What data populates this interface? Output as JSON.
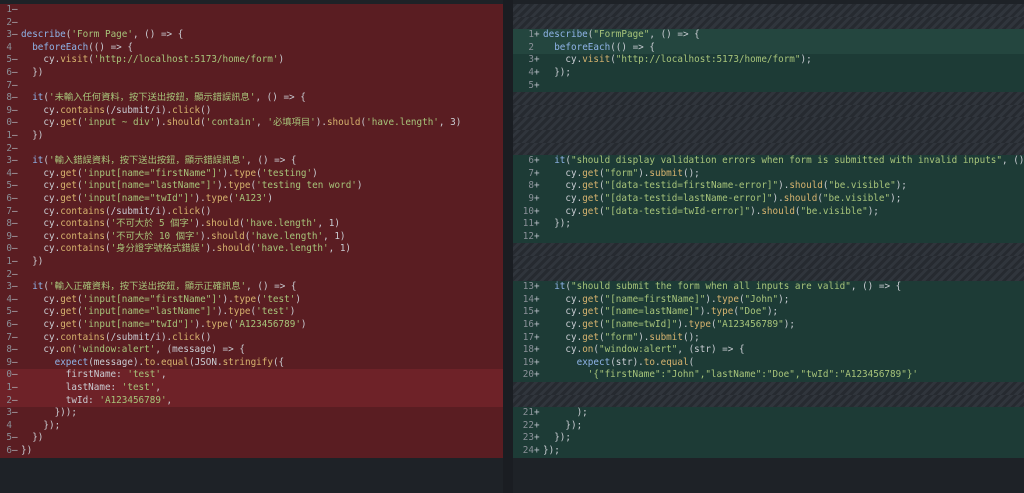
{
  "left_pane": {
    "lines": [
      {
        "n": "1",
        "sign": "—",
        "text": ""
      },
      {
        "n": "2",
        "sign": "—",
        "text": ""
      },
      {
        "n": "3",
        "sign": "—",
        "text": "describe('Form Page', () => {"
      },
      {
        "n": "4",
        "sign": "",
        "text": "  beforeEach(() => {"
      },
      {
        "n": "5",
        "sign": "—",
        "text": "    cy.visit('http://localhost:5173/home/form')"
      },
      {
        "n": "6",
        "sign": "—",
        "text": "  })"
      },
      {
        "n": "7",
        "sign": "—",
        "text": ""
      },
      {
        "n": "8",
        "sign": "—",
        "text": "  it('未輸入任何資料，按下送出按鈕，顯示錯誤訊息', () => {"
      },
      {
        "n": "9",
        "sign": "—",
        "text": "    cy.contains(/submit/i).click()"
      },
      {
        "n": "0",
        "sign": "—",
        "text": "    cy.get('input ~ div').should('contain', '必填項目').should('have.length', 3)"
      },
      {
        "n": "1",
        "sign": "—",
        "text": "  })"
      },
      {
        "n": "2",
        "sign": "—",
        "text": ""
      },
      {
        "n": "3",
        "sign": "—",
        "text": "  it('輸入錯誤資料，按下送出按鈕，顯示錯誤訊息', () => {"
      },
      {
        "n": "4",
        "sign": "—",
        "text": "    cy.get('input[name=\"firstName\"]').type('testing')"
      },
      {
        "n": "5",
        "sign": "—",
        "text": "    cy.get('input[name=\"lastName\"]').type('testing ten word')"
      },
      {
        "n": "6",
        "sign": "—",
        "text": "    cy.get('input[name=\"twId\"]').type('A123')"
      },
      {
        "n": "7",
        "sign": "—",
        "text": "    cy.contains(/submit/i).click()"
      },
      {
        "n": "8",
        "sign": "—",
        "text": "    cy.contains('不可大於 5 個字').should('have.length', 1)"
      },
      {
        "n": "9",
        "sign": "—",
        "text": "    cy.contains('不可大於 10 個字').should('have.length', 1)"
      },
      {
        "n": "0",
        "sign": "—",
        "text": "    cy.contains('身分證字號格式錯誤').should('have.length', 1)"
      },
      {
        "n": "1",
        "sign": "—",
        "text": "  })"
      },
      {
        "n": "2",
        "sign": "—",
        "text": ""
      },
      {
        "n": "3",
        "sign": "—",
        "text": "  it('輸入正確資料，按下送出按鈕，顯示正確訊息', () => {"
      },
      {
        "n": "4",
        "sign": "—",
        "text": "    cy.get('input[name=\"firstName\"]').type('test')"
      },
      {
        "n": "5",
        "sign": "—",
        "text": "    cy.get('input[name=\"lastName\"]').type('test')"
      },
      {
        "n": "6",
        "sign": "—",
        "text": "    cy.get('input[name=\"twId\"]').type('A123456789')"
      },
      {
        "n": "7",
        "sign": "—",
        "text": "    cy.contains(/submit/i).click()"
      },
      {
        "n": "8",
        "sign": "—",
        "text": "    cy.on('window:alert', (message) => {"
      },
      {
        "n": "9",
        "sign": "—",
        "text": "      expect(message).to.equal(JSON.stringify({"
      },
      {
        "n": "0",
        "sign": "—",
        "text": "        firstName: 'test',"
      },
      {
        "n": "1",
        "sign": "—",
        "text": "        lastName: 'test',"
      },
      {
        "n": "2",
        "sign": "—",
        "text": "        twId: 'A123456789',"
      },
      {
        "n": "3",
        "sign": "—",
        "text": "      }));"
      },
      {
        "n": "4",
        "sign": "",
        "text": "    });"
      },
      {
        "n": "5",
        "sign": "—",
        "text": "  })"
      },
      {
        "n": "6",
        "sign": "—",
        "text": "})"
      }
    ]
  },
  "right_pane": {
    "lines": [
      {
        "n": "",
        "sign": "",
        "text": ""
      },
      {
        "n": "",
        "sign": "",
        "text": ""
      },
      {
        "n": "1",
        "sign": "+",
        "text": "describe(\"FormPage\", () => {"
      },
      {
        "n": "2",
        "sign": "",
        "text": "  beforeEach(() => {"
      },
      {
        "n": "3",
        "sign": "+",
        "text": "    cy.visit(\"http://localhost:5173/home/form\");"
      },
      {
        "n": "4",
        "sign": "+",
        "text": "  });"
      },
      {
        "n": "5",
        "sign": "+",
        "text": ""
      },
      {
        "n": "",
        "sign": "",
        "text": ""
      },
      {
        "n": "",
        "sign": "",
        "text": ""
      },
      {
        "n": "",
        "sign": "",
        "text": ""
      },
      {
        "n": "",
        "sign": "",
        "text": ""
      },
      {
        "n": "",
        "sign": "",
        "text": ""
      },
      {
        "n": "6",
        "sign": "+",
        "text": "  it(\"should display validation errors when form is submitted with invalid inputs\", () => {"
      },
      {
        "n": "7",
        "sign": "+",
        "text": "    cy.get(\"form\").submit();"
      },
      {
        "n": "8",
        "sign": "+",
        "text": "    cy.get(\"[data-testid=firstName-error]\").should(\"be.visible\");"
      },
      {
        "n": "9",
        "sign": "+",
        "text": "    cy.get(\"[data-testid=lastName-error]\").should(\"be.visible\");"
      },
      {
        "n": "10",
        "sign": "+",
        "text": "    cy.get(\"[data-testid=twId-error]\").should(\"be.visible\");"
      },
      {
        "n": "11",
        "sign": "+",
        "text": "  });"
      },
      {
        "n": "12",
        "sign": "+",
        "text": ""
      },
      {
        "n": "",
        "sign": "",
        "text": ""
      },
      {
        "n": "",
        "sign": "",
        "text": ""
      },
      {
        "n": "",
        "sign": "",
        "text": ""
      },
      {
        "n": "13",
        "sign": "+",
        "text": "  it(\"should submit the form when all inputs are valid\", () => {"
      },
      {
        "n": "14",
        "sign": "+",
        "text": "    cy.get(\"[name=firstName]\").type(\"John\");"
      },
      {
        "n": "15",
        "sign": "+",
        "text": "    cy.get(\"[name=lastName]\").type(\"Doe\");"
      },
      {
        "n": "16",
        "sign": "+",
        "text": "    cy.get(\"[name=twId]\").type(\"A123456789\");"
      },
      {
        "n": "17",
        "sign": "+",
        "text": "    cy.get(\"form\").submit();"
      },
      {
        "n": "18",
        "sign": "+",
        "text": "    cy.on(\"window:alert\", (str) => {"
      },
      {
        "n": "19",
        "sign": "+",
        "text": "      expect(str).to.equal("
      },
      {
        "n": "20",
        "sign": "+",
        "text": "        '{\"firstName\":\"John\",\"lastName\":\"Doe\",\"twId\":\"A123456789\"}'"
      },
      {
        "n": "",
        "sign": "",
        "text": ""
      },
      {
        "n": "",
        "sign": "",
        "text": ""
      },
      {
        "n": "21",
        "sign": "+",
        "text": "      );"
      },
      {
        "n": "22",
        "sign": "+",
        "text": "    });"
      },
      {
        "n": "23",
        "sign": "+",
        "text": "  });"
      },
      {
        "n": "24",
        "sign": "+",
        "text": "});"
      }
    ]
  },
  "colors": {
    "deleted": "#5a1d22",
    "added": "#1d3b36",
    "filler": "#2b2f35"
  }
}
